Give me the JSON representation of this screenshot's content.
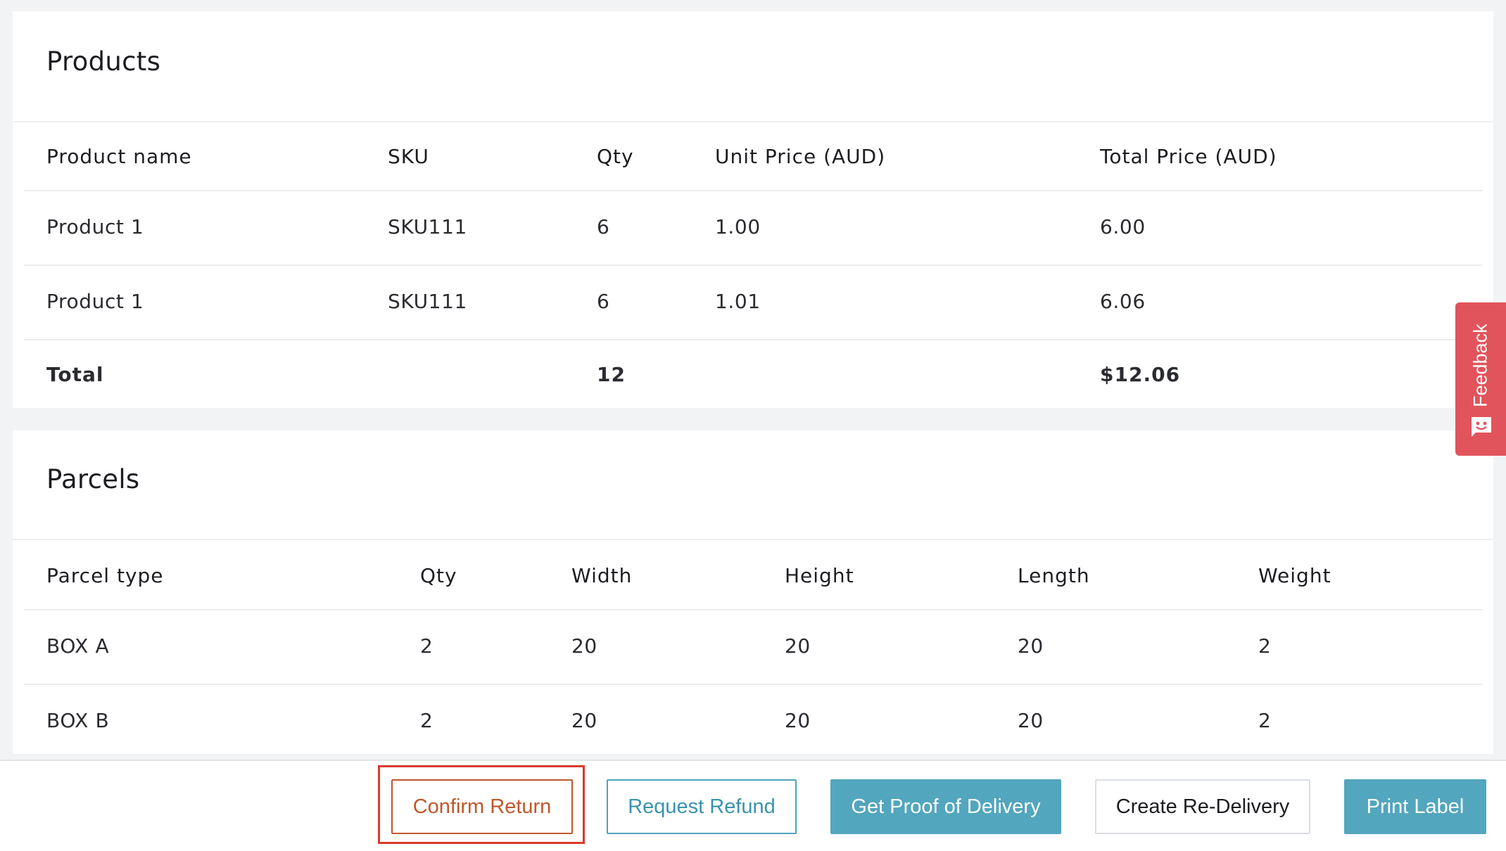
{
  "products": {
    "title": "Products",
    "columns": [
      "Product name",
      "SKU",
      "Qty",
      "Unit Price (AUD)",
      "Total Price (AUD)"
    ],
    "rows": [
      [
        "Product 1",
        "SKU111",
        "6",
        "1.00",
        "6.00"
      ],
      [
        "Product 1",
        "SKU111",
        "6",
        "1.01",
        "6.06"
      ]
    ],
    "total": {
      "label": "Total",
      "qty": "12",
      "price": "$12.06"
    }
  },
  "parcels": {
    "title": "Parcels",
    "columns": [
      "Parcel type",
      "Qty",
      "Width",
      "Height",
      "Length",
      "Weight"
    ],
    "rows": [
      [
        "BOX A",
        "2",
        "20",
        "20",
        "20",
        "2"
      ],
      [
        "BOX B",
        "2",
        "20",
        "20",
        "20",
        "2"
      ]
    ]
  },
  "actions": {
    "confirm_return": "Confirm Return",
    "request_refund": "Request Refund",
    "proof_of_delivery": "Get Proof of Delivery",
    "re_delivery": "Create Re-Delivery",
    "print_label": "Print Label"
  },
  "feedback": {
    "label": "Feedback",
    "icon": "chat-face-icon"
  },
  "colors": {
    "accent": "#52a6bd",
    "confirm": "#c0572a",
    "highlight": "#d9392b",
    "feedback": "#e2545c"
  }
}
